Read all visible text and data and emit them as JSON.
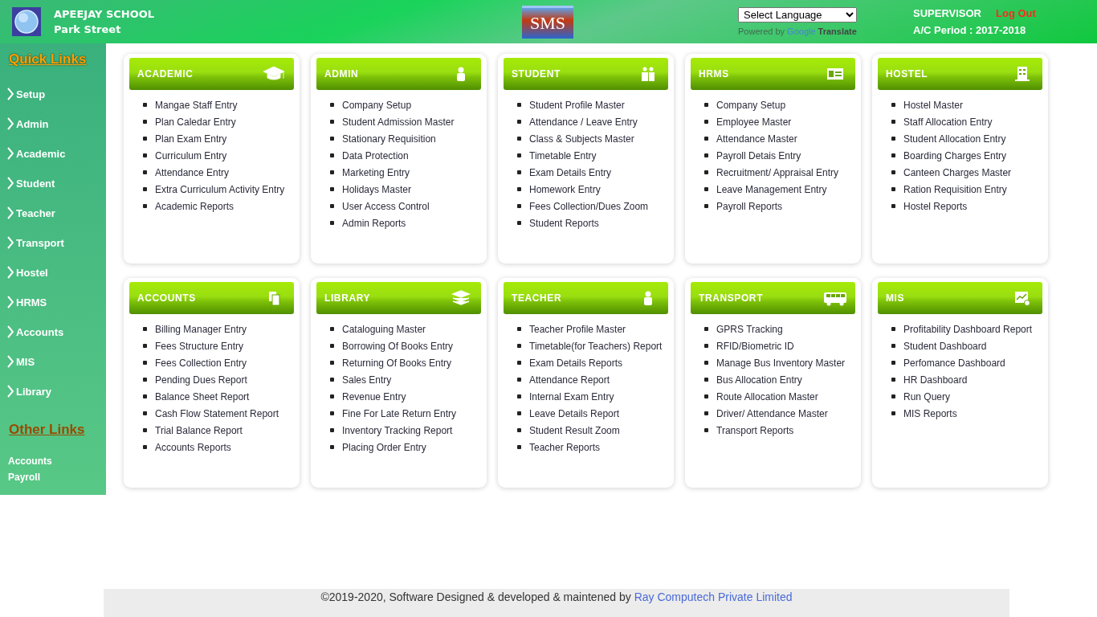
{
  "header": {
    "school_name": "APEEJAY SCHOOL",
    "branch": "Park Street",
    "app_logo": "SMS",
    "language_select": {
      "value": "Select Language"
    },
    "powered_by": "Powered by",
    "google": "Google",
    "translate": "Translate",
    "user": "SUPERVISOR",
    "logout": "Log Out",
    "period": "A/C Period : 2017-2018"
  },
  "sidebar": {
    "quick_links_title": "Quick Links",
    "items": [
      "Setup",
      "Admin",
      "Academic",
      "Student",
      "Teacher",
      "Transport",
      "Hostel",
      "HRMS",
      "Accounts",
      "MIS",
      "Library"
    ],
    "other_links_title": "Other Links",
    "other_items": [
      "Accounts",
      "Payroll"
    ]
  },
  "cards": [
    {
      "title": "ACADEMIC",
      "links": [
        "Mangae Staff Entry",
        "Plan Caledar Entry",
        "Plan Exam Entry",
        "Curriculum Entry",
        "Attendance Entry",
        "Extra Curriculum Activity Entry",
        "Academic Reports"
      ]
    },
    {
      "title": "ADMIN",
      "links": [
        "Company Setup",
        "Student Admission Master",
        "Stationary Requisition",
        "Data Protection",
        "Marketing Entry",
        "Holidays Master",
        "User Access Control",
        "Admin Reports"
      ]
    },
    {
      "title": "STUDENT",
      "links": [
        "Student Profile Master",
        "Attendance / Leave Entry",
        "Class & Subjects Master",
        "Timetable Entry",
        "Exam Details Entry",
        "Homework Entry",
        "Fees Collection/Dues Zoom",
        "Student Reports"
      ]
    },
    {
      "title": "HRMS",
      "links": [
        "Company Setup",
        "Employee Master",
        "Attendance Master",
        "Payroll Detais Entry",
        "Recruitment/ Appraisal Entry",
        "Leave Management Entry",
        "Payroll Reports"
      ]
    },
    {
      "title": "HOSTEL",
      "links": [
        "Hostel Master",
        "Staff Allocation Entry",
        "Student Allocation Entry",
        "Boarding Charges Entry",
        "Canteen Charges Master",
        "Ration Requisition Entry",
        "Hostel Reports"
      ]
    },
    {
      "title": "ACCOUNTS",
      "links": [
        "Billing Manager Entry",
        "Fees Structure Entry",
        "Fees Collection Entry",
        "Pending Dues Report",
        "Balance Sheet Report",
        "Cash Flow Statement Report",
        "Trial Balance Report",
        "Accounts Reports"
      ]
    },
    {
      "title": "LIBRARY",
      "links": [
        "Cataloguing Master",
        "Borrowing Of Books Entry",
        "Returning Of Books Entry",
        "Sales Entry",
        "Revenue Entry",
        "Fine For Late Return Entry",
        "Inventory Tracking Report",
        "Placing Order Entry"
      ]
    },
    {
      "title": "TEACHER",
      "links": [
        "Teacher Profile Master",
        "Timetable(for Teachers) Report",
        "Exam Details Reports",
        "Attendance Report",
        "Internal Exam Entry",
        "Leave Details Report",
        "Student Result Zoom",
        "Teacher Reports"
      ]
    },
    {
      "title": "TRANSPORT",
      "links": [
        "GPRS Tracking",
        "RFID/Biometric ID",
        "Manage Bus Inventory Master",
        "Bus Allocation Entry",
        "Route Allocation Master",
        "Driver/ Attendance Master",
        "Transport Reports"
      ]
    },
    {
      "title": "MIS",
      "links": [
        "Profitability Dashboard Report",
        "Student Dashboard",
        "Perfomance Dashboard",
        "HR Dashboard",
        "Run Query",
        "MIS Reports"
      ]
    }
  ],
  "footer": {
    "text": "©2019-2020, Software Designed & developed & maintened by",
    "link": "Ray Computech Private Limited"
  }
}
